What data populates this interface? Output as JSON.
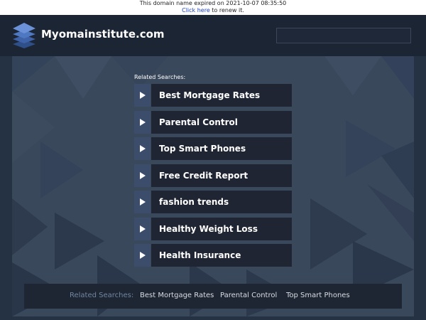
{
  "notice": {
    "expired_text": "This domain name expired on 2021-10-07 08:35:50",
    "click_here": "Click here",
    "renew_text": " to renew it."
  },
  "header": {
    "site_title": "Myomainstitute.com",
    "logo_icon": "stacked-layers-icon",
    "search_placeholder": ""
  },
  "related": {
    "title": "Related Searches:",
    "links": [
      "Best Mortgage Rates",
      "Parental Control",
      "Top Smart Phones",
      "Free Credit Report",
      "fashion trends",
      "Healthy Weight Loss",
      "Health Insurance"
    ]
  },
  "footer": {
    "label": "Related Searches:",
    "links": [
      "Best Mortgage Rates",
      "Parental Control",
      "Top Smart Phones"
    ]
  },
  "colors": {
    "background": "#243244",
    "header": "#1c2533",
    "panel": "#3a485c",
    "link_bg": "#1f2532",
    "arrow_bg": "#3c4d6c",
    "footer_label": "#6f86a0"
  }
}
